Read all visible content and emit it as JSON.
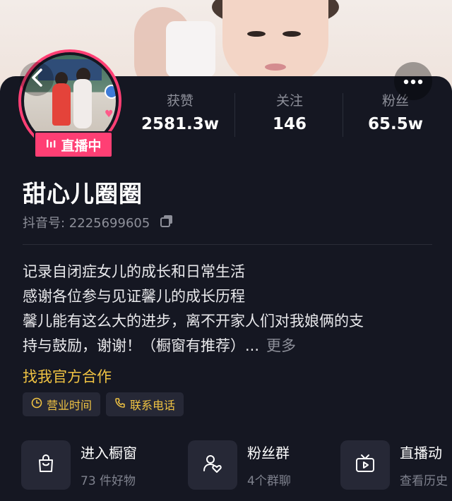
{
  "profile": {
    "live_badge": "直播中",
    "name": "甜心儿圈圈",
    "douyin_id": "抖音号: 2225699605"
  },
  "stats": {
    "likes_label": "获赞",
    "likes_value": "2581.3w",
    "following_label": "关注",
    "following_value": "146",
    "fans_label": "粉丝",
    "fans_value": "65.5w"
  },
  "bio": {
    "lines": [
      "记录自闭症女儿的成长和日常生活",
      "感谢各位参与见证馨儿的成长历程",
      "馨儿能有这么大的进步，离不开家人们对我娘俩的支",
      "持与鼓励，谢谢！（橱窗有推荐）..."
    ],
    "more": "更多"
  },
  "cooperate": "找我官方合作",
  "tags": {
    "hours": "营业时间",
    "phone": "联系电话"
  },
  "features": {
    "shop_title": "进入橱窗",
    "shop_sub": "73 件好物",
    "fans_title": "粉丝群",
    "fans_sub": "4个群聊",
    "live_title": "直播动",
    "live_sub": "查看历史"
  },
  "colors": {
    "panel_bg": "#151722",
    "accent_pink": "#ff3f74",
    "accent_gold": "#f0c343",
    "muted": "#8d8f99"
  },
  "icons": {
    "back": "chevron-left-icon",
    "more": "more-dots-icon",
    "live": "live-bars-icon",
    "copy": "copy-icon",
    "clock": "clock-icon",
    "phone": "phone-icon",
    "shop": "shopping-bag-icon",
    "fans": "group-heart-icon",
    "tv": "tv-play-icon"
  }
}
